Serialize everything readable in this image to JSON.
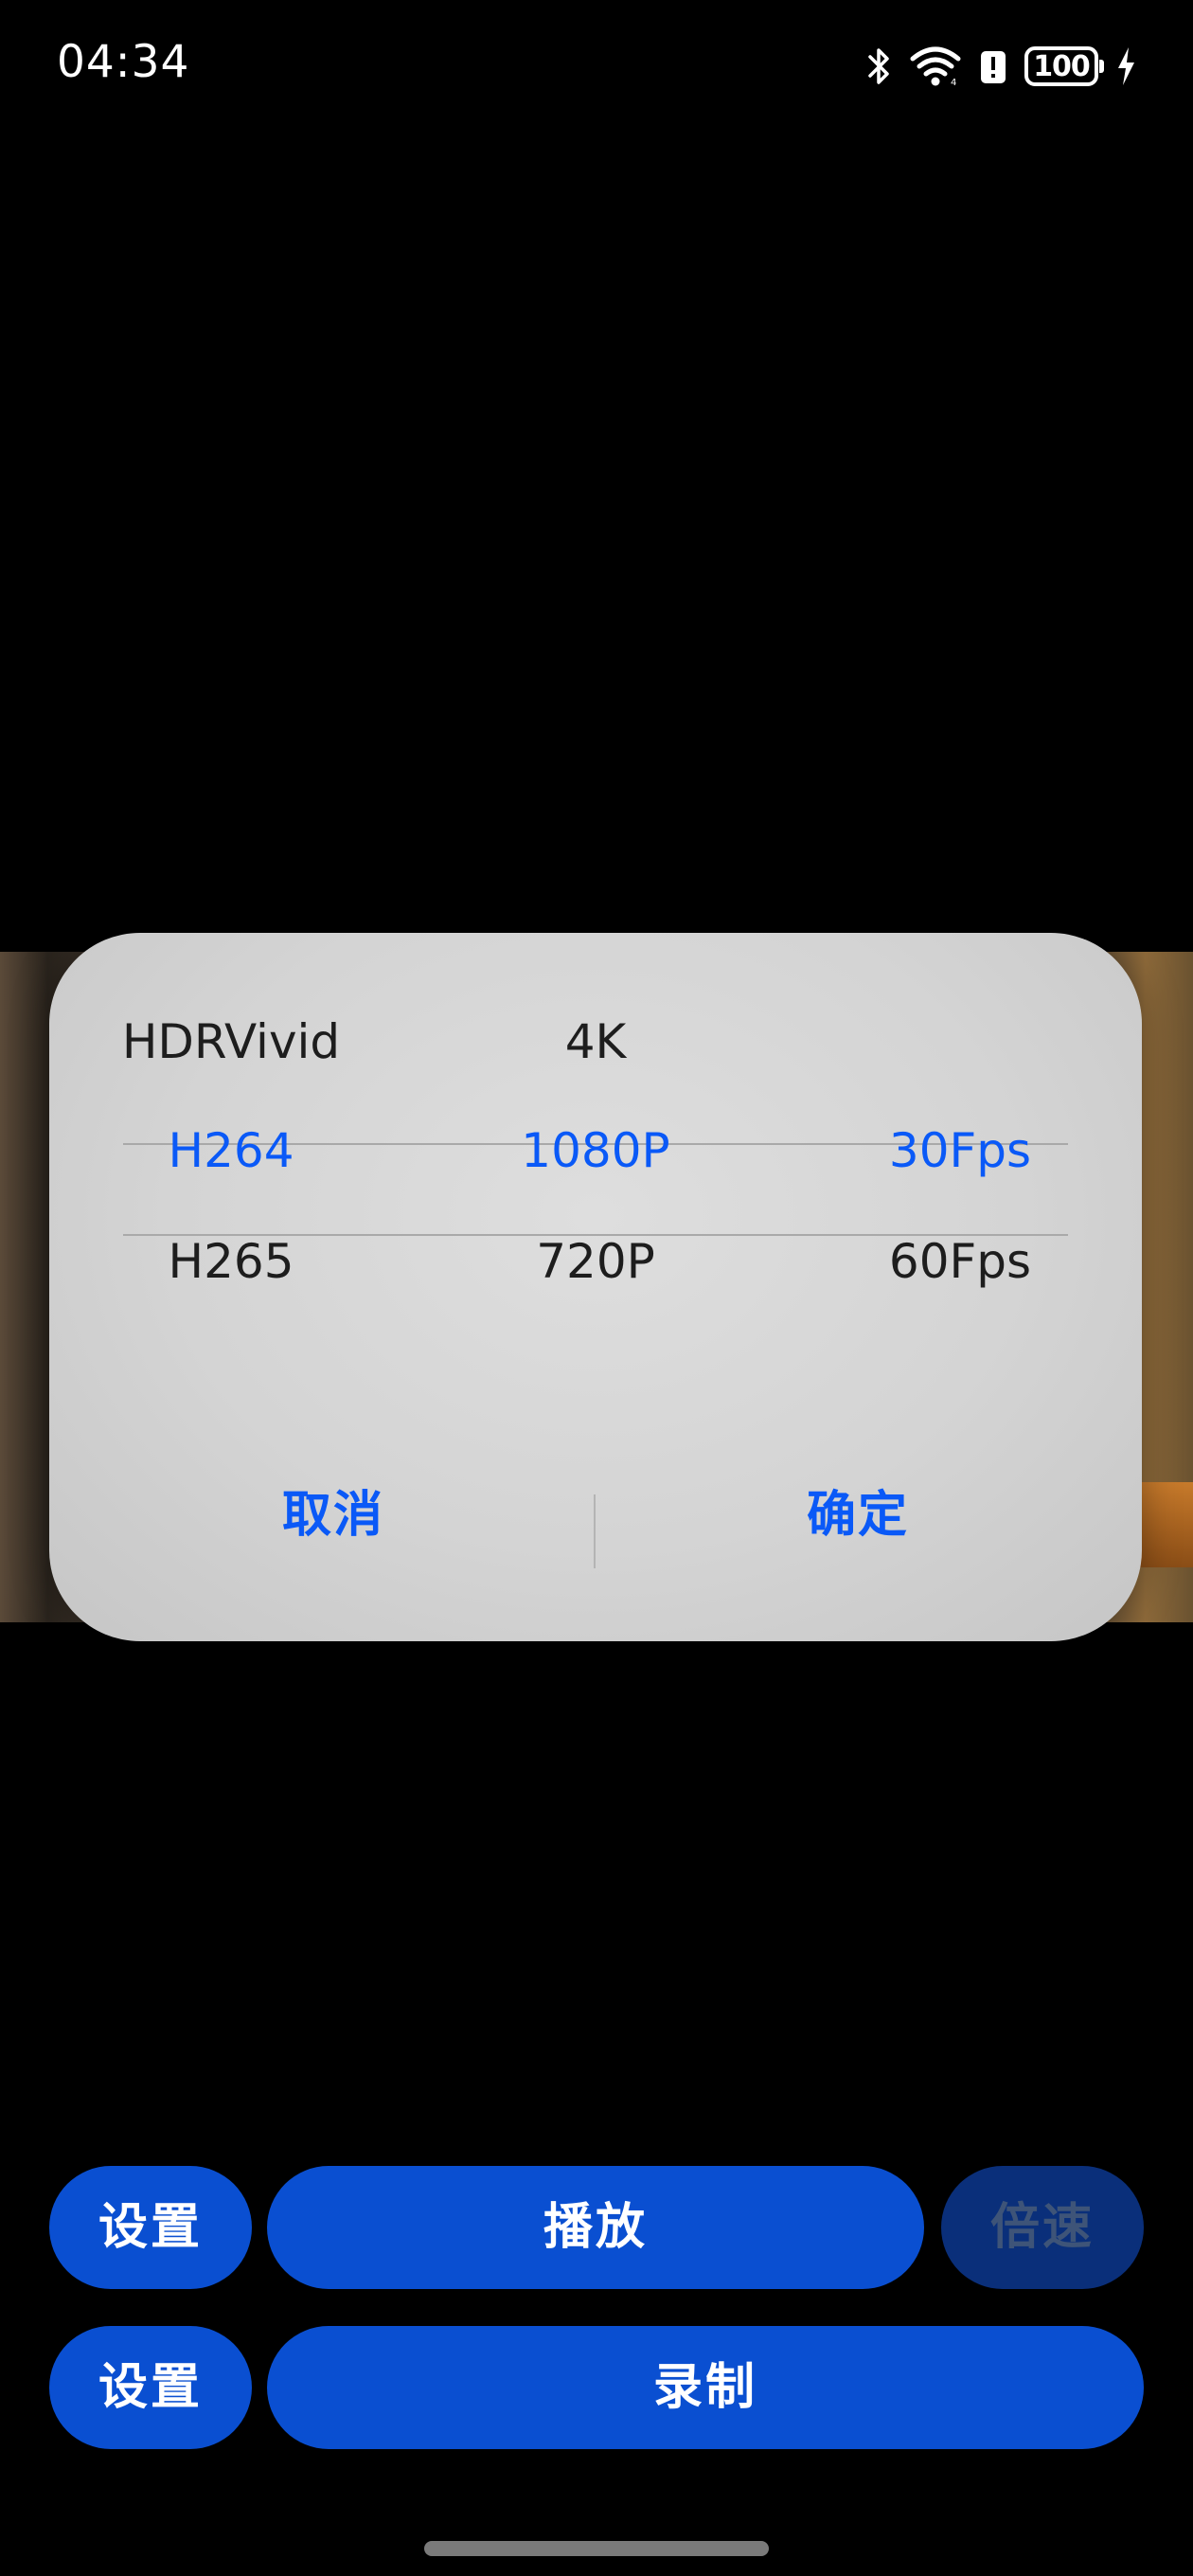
{
  "status_bar": {
    "time": "04:34",
    "battery_level": "100",
    "icons": [
      "bluetooth-icon",
      "wifi-icon",
      "alert-icon",
      "battery-icon",
      "charging-icon"
    ]
  },
  "dialog": {
    "picker": {
      "rows": [
        {
          "codec": "HDRVivid",
          "resolution": "4K",
          "fps": ""
        },
        {
          "codec": "H264",
          "resolution": "1080P",
          "fps": "30Fps"
        },
        {
          "codec": "H265",
          "resolution": "720P",
          "fps": "60Fps"
        }
      ],
      "selected_index": 1
    },
    "cancel_label": "取消",
    "confirm_label": "确定"
  },
  "controls": {
    "row1": {
      "settings_label": "设置",
      "play_label": "播放",
      "speed_label": "倍速"
    },
    "row2": {
      "settings_label": "设置",
      "record_label": "录制"
    }
  },
  "colors": {
    "accent": "#0a59f7",
    "button_bg": "#0a4fd1",
    "button_disabled_bg": "#0a2f7a"
  }
}
